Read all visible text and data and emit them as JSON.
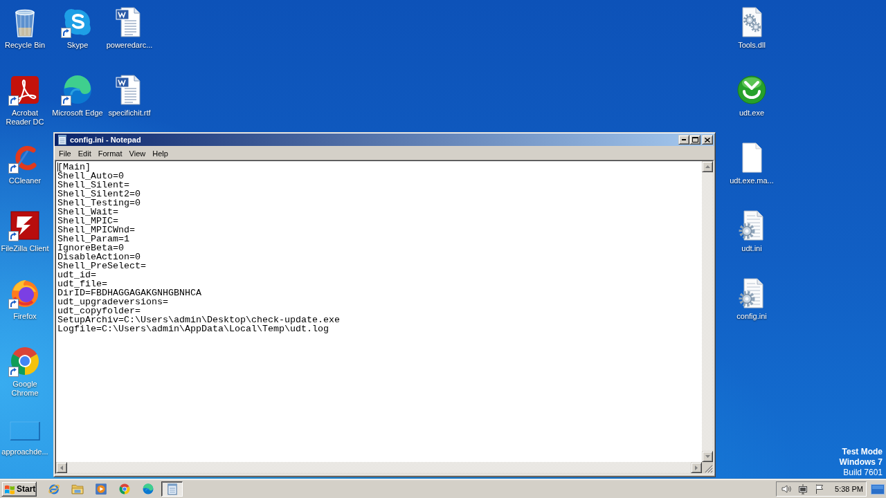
{
  "desktop": {
    "left_columns": [
      [
        {
          "label": "Recycle Bin",
          "kind": "recycle-bin",
          "shortcut": false
        },
        {
          "label": "Acrobat Reader DC",
          "kind": "acrobat",
          "shortcut": true
        },
        {
          "label": "CCleaner",
          "kind": "ccleaner",
          "shortcut": true
        },
        {
          "label": "FileZilla Client",
          "kind": "filezilla",
          "shortcut": true
        },
        {
          "label": "Firefox",
          "kind": "firefox",
          "shortcut": true
        },
        {
          "label": "Google Chrome",
          "kind": "chrome",
          "shortcut": true
        },
        {
          "label": "approachde...",
          "kind": "thumbnail",
          "shortcut": false
        }
      ],
      [
        {
          "label": "Skype",
          "kind": "skype",
          "shortcut": true
        },
        {
          "label": "Microsoft Edge",
          "kind": "edge",
          "shortcut": true
        }
      ],
      [
        {
          "label": "poweredarc...",
          "kind": "word-doc",
          "shortcut": false
        },
        {
          "label": "specifichit.rtf",
          "kind": "word-doc",
          "shortcut": false
        }
      ]
    ],
    "right_columns": [
      [
        {
          "label": "Tools.dll",
          "kind": "dll",
          "shortcut": false
        },
        {
          "label": "udt.exe",
          "kind": "udt",
          "shortcut": false
        },
        {
          "label": "udt.exe.ma...",
          "kind": "blank-doc",
          "shortcut": false
        },
        {
          "label": "udt.ini",
          "kind": "ini",
          "shortcut": false
        },
        {
          "label": "config.ini",
          "kind": "ini",
          "shortcut": false
        }
      ]
    ],
    "notice": [
      {
        "text": "Test Mode",
        "bold": true
      },
      {
        "text": "Windows 7",
        "bold": true
      },
      {
        "text": "Build 7601",
        "bold": false
      }
    ]
  },
  "notepad": {
    "title": "config.ini - Notepad",
    "menu": [
      "File",
      "Edit",
      "Format",
      "View",
      "Help"
    ],
    "lines": [
      "[Main]",
      "Shell_Auto=0",
      "Shell_Silent=",
      "Shell_Silent2=0",
      "Shell_Testing=0",
      "Shell_Wait=",
      "Shell_MPIC=",
      "Shell_MPICWnd=",
      "Shell_Param=1",
      "IgnoreBeta=0",
      "DisableAction=0",
      "Shell_PreSelect=",
      "udt_id=",
      "udt_file=",
      "DirID=FBDHAGGAGAKGNHGBNHCA",
      "udt_upgradeversions=",
      "udt_copyfolder=",
      "SetupArchiv=C:\\Users\\admin\\Desktop\\check-update.exe",
      "Logfile=C:\\Users\\admin\\AppData\\Local\\Temp\\udt.log"
    ]
  },
  "taskbar": {
    "start": "Start",
    "quick_launch": [
      {
        "kind": "ie"
      },
      {
        "kind": "folder"
      },
      {
        "kind": "media-player"
      },
      {
        "kind": "chrome"
      },
      {
        "kind": "edge"
      }
    ],
    "tasks": [
      {
        "kind": "notepad",
        "selected": true
      }
    ],
    "tray": [
      {
        "kind": "speaker"
      },
      {
        "kind": "network"
      },
      {
        "kind": "flag"
      }
    ],
    "clock": "5:38 PM"
  }
}
